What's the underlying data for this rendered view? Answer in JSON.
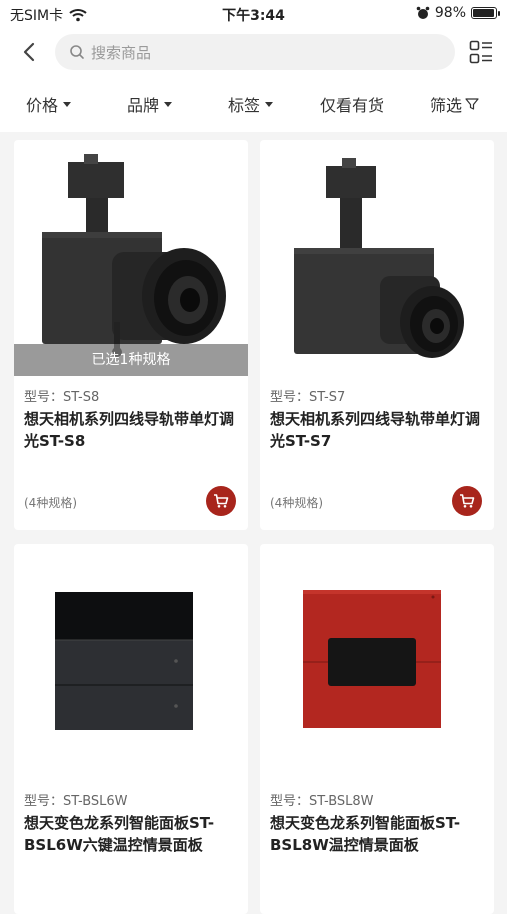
{
  "status": {
    "carrier": "无SIM卡",
    "time": "下午3:44",
    "battery": "98%",
    "battery_level": 0.98
  },
  "search": {
    "placeholder": "搜索商品"
  },
  "filters": [
    {
      "label": "价格",
      "caret": true
    },
    {
      "label": "品牌",
      "caret": true
    },
    {
      "label": "标签",
      "caret": true
    },
    {
      "label": "仅看有货",
      "caret": false
    },
    {
      "label": "筛选",
      "caret": false
    }
  ],
  "products": [
    {
      "model": "型号：ST-S8",
      "title": "想天相机系列四线导轨带单灯调光ST-S8",
      "specs": "(4种规格)",
      "selected": "已选1种规格",
      "image": "camera-track-light"
    },
    {
      "model": "型号：ST-S7",
      "title": "想天相机系列四线导轨带单灯调光ST-S7",
      "specs": "(4种规格)",
      "selected": "",
      "image": "camera-track-light"
    },
    {
      "model": "型号：ST-BSL6W",
      "title": "想天变色龙系列智能面板ST-BSL6W六键温控情景面板",
      "specs": "(4种规格)",
      "selected": "",
      "image": "black-panel"
    },
    {
      "model": "型号：ST-BSL8W",
      "title": "想天变色龙系列智能面板ST-BSL8W温控情景面板",
      "specs": "(4种规格)",
      "selected": "",
      "image": "red-panel"
    }
  ],
  "colors": {
    "accent": "#a8251c",
    "panel_red": "#b32720"
  }
}
